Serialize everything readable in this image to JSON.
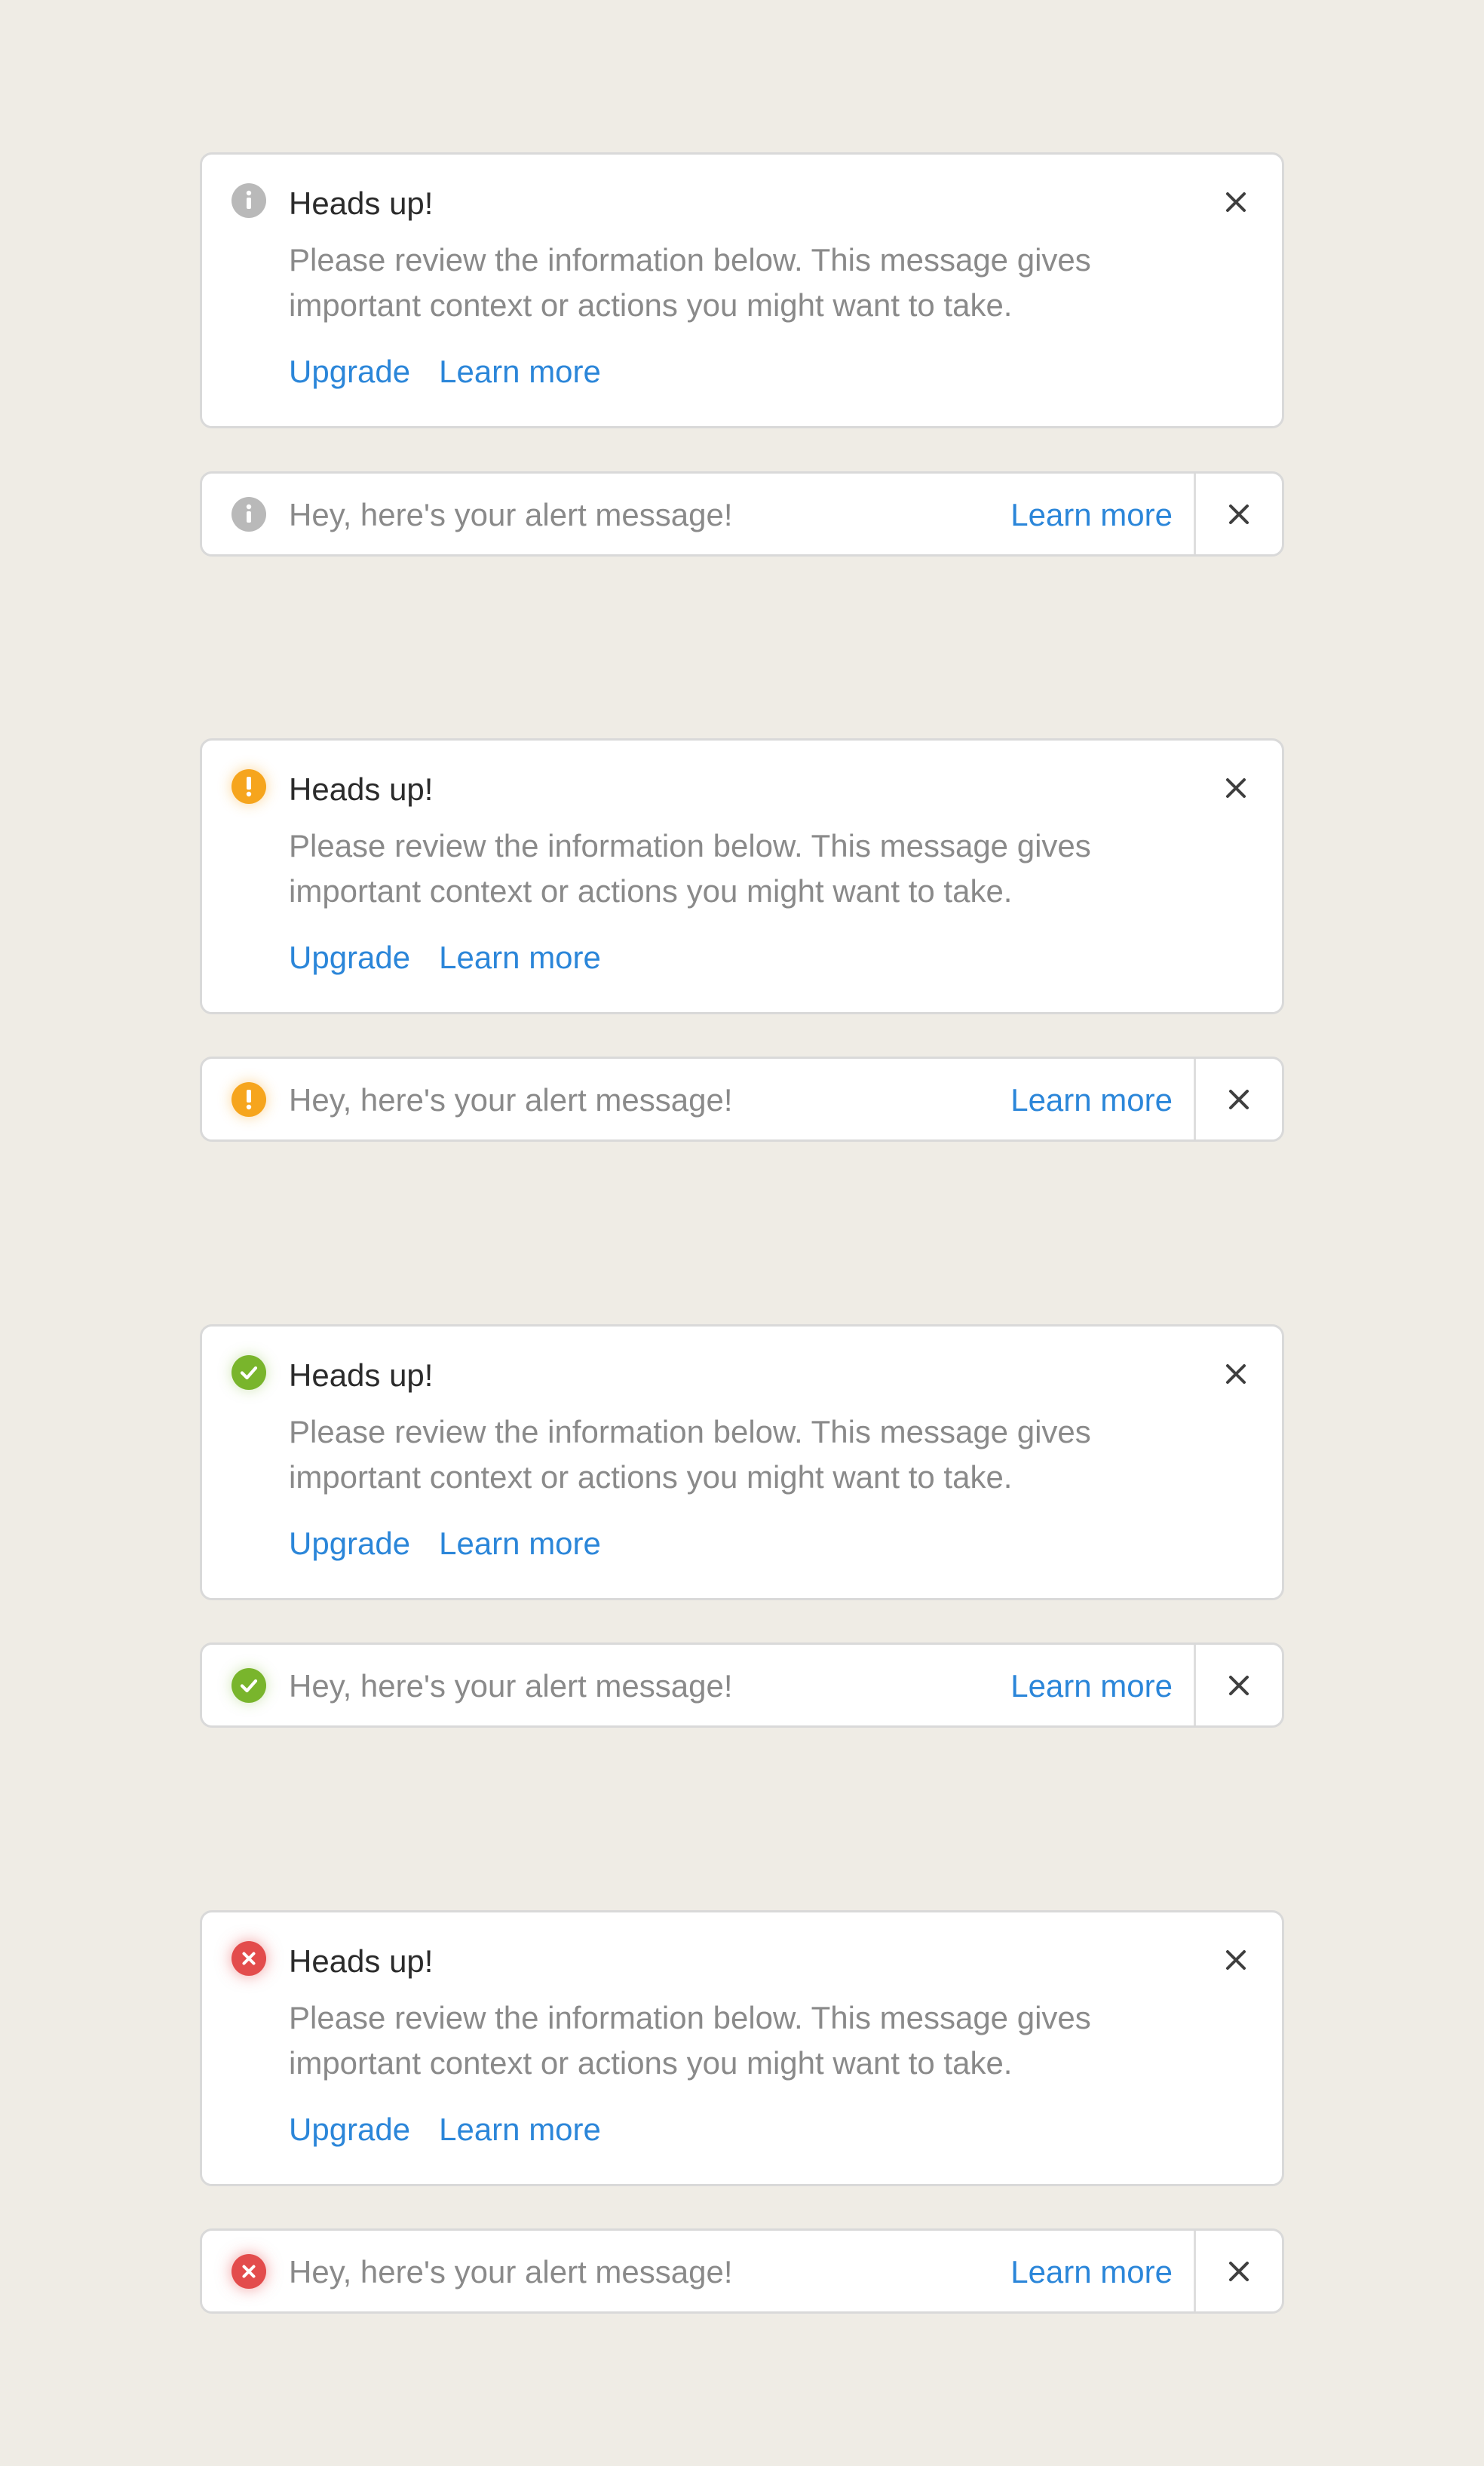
{
  "alerts": [
    {
      "variant": "info",
      "icon": "info-icon",
      "color": "#b9b9b9",
      "title": "Heads up!",
      "body": "Please review the information below. This message gives important context or actions you might want to take.",
      "primary_action": "Upgrade",
      "secondary_action": "Learn more",
      "inline_message": "Hey, here's your alert message!",
      "inline_link": "Learn more"
    },
    {
      "variant": "warning",
      "icon": "warning-icon",
      "color": "#f6a51d",
      "title": "Heads up!",
      "body": "Please review the information below. This message gives important context or actions you might want to take.",
      "primary_action": "Upgrade",
      "secondary_action": "Learn more",
      "inline_message": "Hey, here's your alert message!",
      "inline_link": "Learn more"
    },
    {
      "variant": "success",
      "icon": "check-icon",
      "color": "#79b52c",
      "title": "Heads up!",
      "body": "Please review the information below. This message gives important context or actions you might want to take.",
      "primary_action": "Upgrade",
      "secondary_action": "Learn more",
      "inline_message": "Hey, here's your alert message!",
      "inline_link": "Learn more"
    },
    {
      "variant": "error",
      "icon": "error-icon",
      "color": "#e34c4c",
      "title": "Heads up!",
      "body": "Please review the information below. This message gives important context or actions you might want to take.",
      "primary_action": "Upgrade",
      "secondary_action": "Learn more",
      "inline_message": "Hey, here's your alert message!",
      "inline_link": "Learn more"
    }
  ],
  "link_color": "#2b86d9",
  "close_icon": "close-icon"
}
